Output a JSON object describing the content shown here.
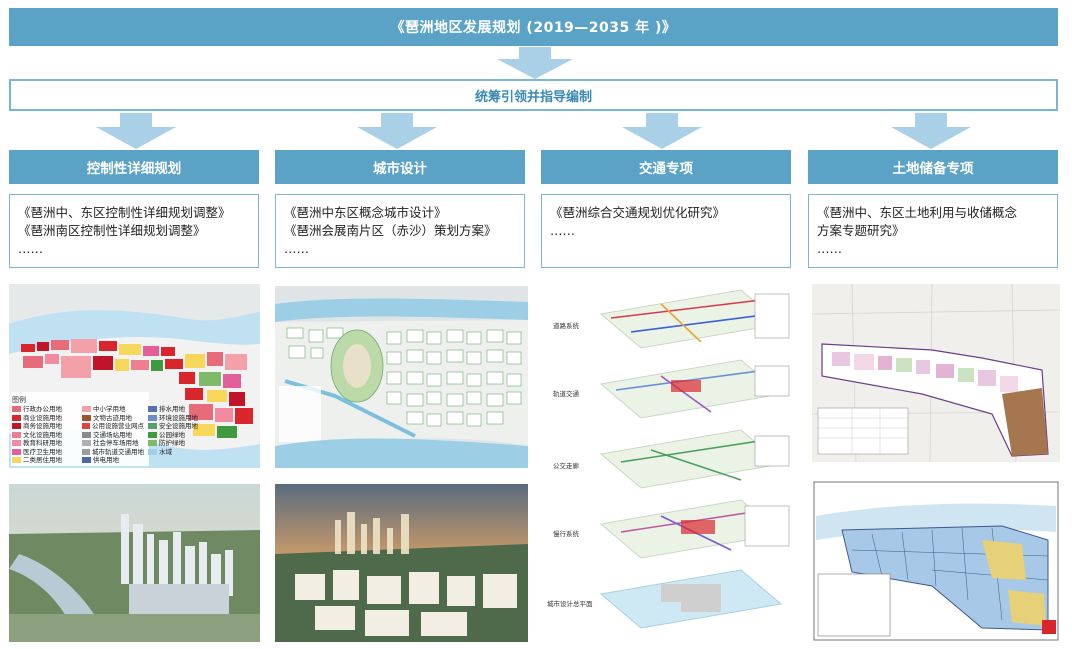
{
  "banner": {
    "title": "《琶洲地区发展规划 (2019—2035 年 )》"
  },
  "subbar": {
    "label": "统筹引领并指导编制"
  },
  "columns": [
    {
      "title": "控制性详细规划",
      "lines": [
        "《琶洲中、东区控制性详细规划调整》",
        "《琶洲南区控制性详细规划调整》",
        "……"
      ]
    },
    {
      "title": "城市设计",
      "lines": [
        "《琶洲中东区概念城市设计》",
        "《琶洲会展南片区（赤沙）策划方案》",
        "……"
      ]
    },
    {
      "title": "交通专项",
      "lines": [
        "《琶洲综合交通规划优化研究》",
        "……"
      ]
    },
    {
      "title": "土地储备专项",
      "lines": [
        "《琶洲中、东区土地利用与收储概念",
        "方案专题研究》",
        "……"
      ]
    }
  ],
  "legend": {
    "title": "图例",
    "items": [
      {
        "label": "行政办公用地",
        "color": "#e86b7a"
      },
      {
        "label": "中小学用地",
        "color": "#f3a0a8"
      },
      {
        "label": "排水用地",
        "color": "#5b6fa8"
      },
      {
        "label": "商业设施用地",
        "color": "#d9262d"
      },
      {
        "label": "文物古迹用地",
        "color": "#a0522d"
      },
      {
        "label": "环境设施用地",
        "color": "#6b8fc0"
      },
      {
        "label": "商务设施用地",
        "color": "#c0142a"
      },
      {
        "label": "公用设施营业网点",
        "color": "#e0433f"
      },
      {
        "label": "安全设施用地",
        "color": "#5aa06a"
      },
      {
        "label": "文化设施用地",
        "color": "#ef7f90"
      },
      {
        "label": "交通场站用地",
        "color": "#8a8a8a"
      },
      {
        "label": "公园绿地",
        "color": "#3f9a3f"
      },
      {
        "label": "教育科研用地",
        "color": "#f28aa0"
      },
      {
        "label": "社会停车场用地",
        "color": "#b0b0b0"
      },
      {
        "label": "防护绿地",
        "color": "#7dbb6a"
      },
      {
        "label": "医疗卫生用地",
        "color": "#e35f9a"
      },
      {
        "label": "城市轨道交通用地",
        "color": "#9d9d9d"
      },
      {
        "label": "水域",
        "color": "#9fd0ea"
      },
      {
        "label": "二类居住用地",
        "color": "#f6d75a"
      },
      {
        "label": "供电用地",
        "color": "#4a67a8"
      }
    ]
  },
  "transport_labels": [
    "道路系统",
    "轨道交通",
    "公交走廊",
    "慢行系统",
    "城市设计总平面"
  ],
  "colors": {
    "primary": "#5aa3c6",
    "border": "#7ab6d3",
    "arrow": "#a9d0e6"
  }
}
